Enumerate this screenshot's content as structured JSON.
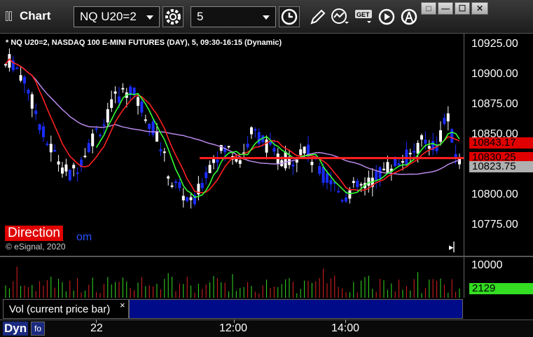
{
  "window": {
    "title": "Chart",
    "symbol_combo": "NQ U20=2",
    "interval_combo": "5"
  },
  "chart": {
    "header": "* NQ U20=2, NASDAQ 100 E-MINI FUTURES (DAY), 5, 09:30-16:15 (Dynamic)",
    "watermark": "Direction",
    "watermark_suffix": "om",
    "copyright": "© eSignal, 2020",
    "price_ticks": [
      "10925.00",
      "10900.00",
      "10875.00",
      "10850.00",
      "10800.00",
      "10775.00"
    ],
    "badges": [
      {
        "label": "10843.17",
        "bg": "#e00000",
        "fg": "#000000"
      },
      {
        "label": "10830.25",
        "bg": "#e00000",
        "fg": "#000000"
      },
      {
        "label": "10823.75",
        "bg": "#b0b0b0",
        "fg": "#000000"
      }
    ],
    "volume_tick": "10000",
    "volume_badge": "2129",
    "colors": {
      "up": "#ffffff",
      "down": "#1a2cff",
      "ma_red": "#ff2020",
      "ma_green": "#33ff33",
      "ma_purple": "#b888e8",
      "flat": "#ff2020"
    }
  },
  "legend": {
    "label": "Vol (current price bar)",
    "close": "×"
  },
  "timebar": {
    "mode": "Dyn",
    "mode_icon": "fo",
    "labels": [
      "22",
      "12:00",
      "14:00"
    ]
  },
  "icons": {
    "settings": "gear-icon",
    "clock": "clock-icon",
    "draw": "pencil-icon",
    "study": "study-icon",
    "get": "get-icon",
    "play": "play-icon",
    "alert": "alert-icon"
  },
  "window_buttons": {
    "restore": "□",
    "minimize": "—",
    "maximize": "☐",
    "close": "✕"
  }
}
